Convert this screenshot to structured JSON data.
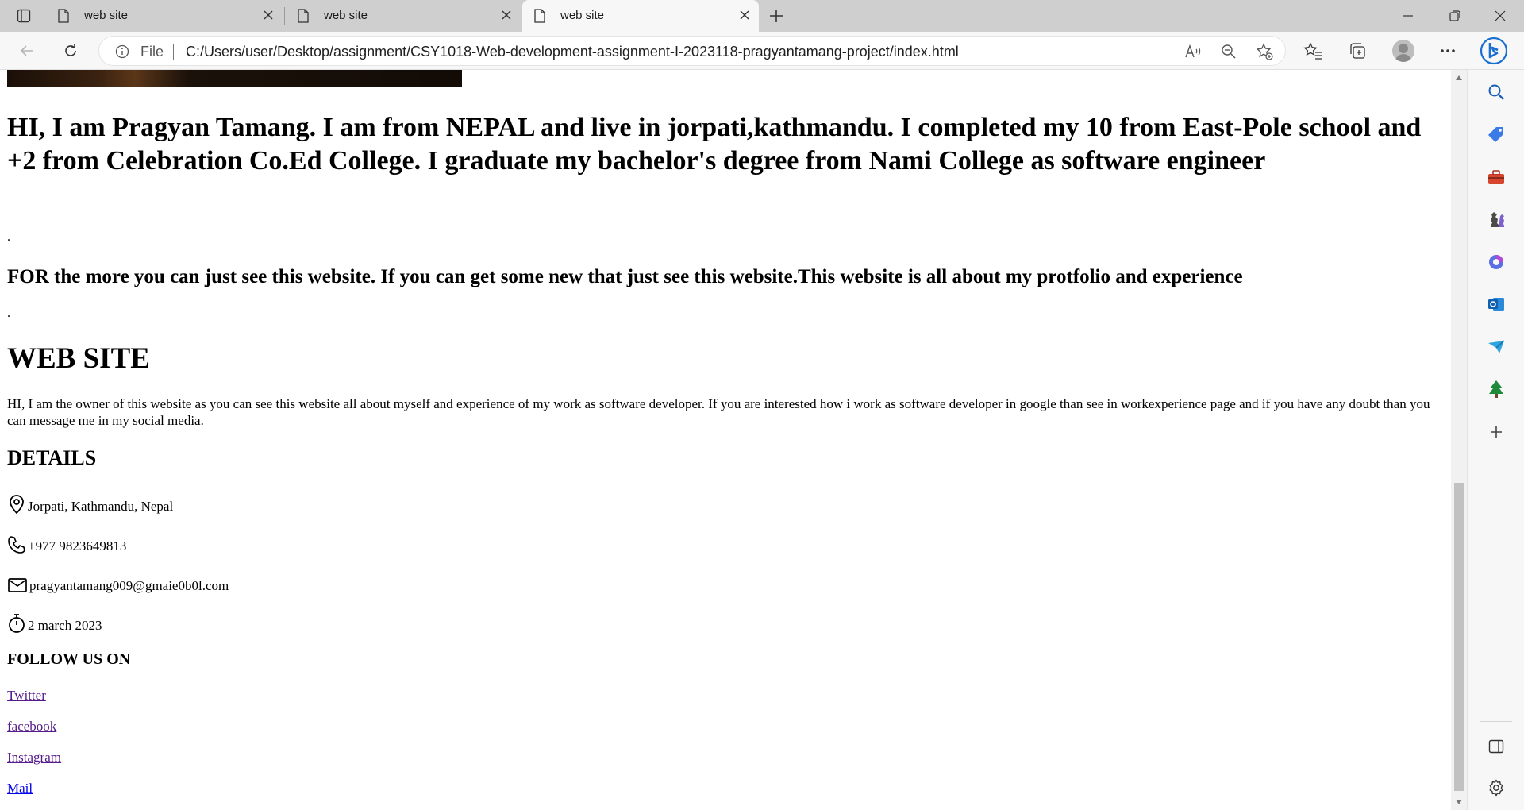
{
  "browser": {
    "tabs": [
      {
        "title": "web site",
        "active": false
      },
      {
        "title": "web site",
        "active": false
      },
      {
        "title": "web site",
        "active": true
      }
    ],
    "address": {
      "scheme_label": "File",
      "url": "C:/Users/user/Desktop/assignment/CSY1018-Web-development-assignment-I-2023118-pragyantamang-project/index.html"
    },
    "colors": {
      "tabstrip": "#cfcfcf",
      "toolbar": "#f7f7f7",
      "link_visited": "#551a8b",
      "link_unvisited": "#0000ee"
    },
    "sidebar_icons": [
      "search-icon",
      "tag-icon",
      "toolbox-icon",
      "games-icon",
      "copilot-icon",
      "outlook-icon",
      "send-icon",
      "tree-icon",
      "add-icon",
      "split-screen-icon",
      "settings-icon"
    ]
  },
  "page": {
    "intro_heading": "HI, I am Pragyan Tamang. I am from NEPAL and live in jorpati,kathmandu. I completed my 10 from East-Pole school and +2 from Celebration Co.Ed College. I graduate my bachelor's degree from Nami College as software engineer",
    "separator_1": ".",
    "more_heading": "FOR the more you can just see this website. If you can get some new that just see this website.This website is all about my protfolio and experience",
    "separator_2": ".",
    "site_title": "WEB SITE",
    "site_description": "HI, I am the owner of this website as you can see this website all about myself and experience of my work as software developer. If you are interested how i work as software developer in google than see in workexperience page and if you have any doubt than you can message me in my social media.",
    "details_title": "DETAILS",
    "details": {
      "location": "Jorpati, Kathmandu, Nepal",
      "phone": "+977 9823649813",
      "email": "pragyantamang009@gmaie0b0l.com",
      "date": "2 march 2023"
    },
    "follow_title": "FOLLOW US ON",
    "social_links": [
      "Twitter",
      "facebook",
      "Instagram",
      "Mail"
    ]
  }
}
